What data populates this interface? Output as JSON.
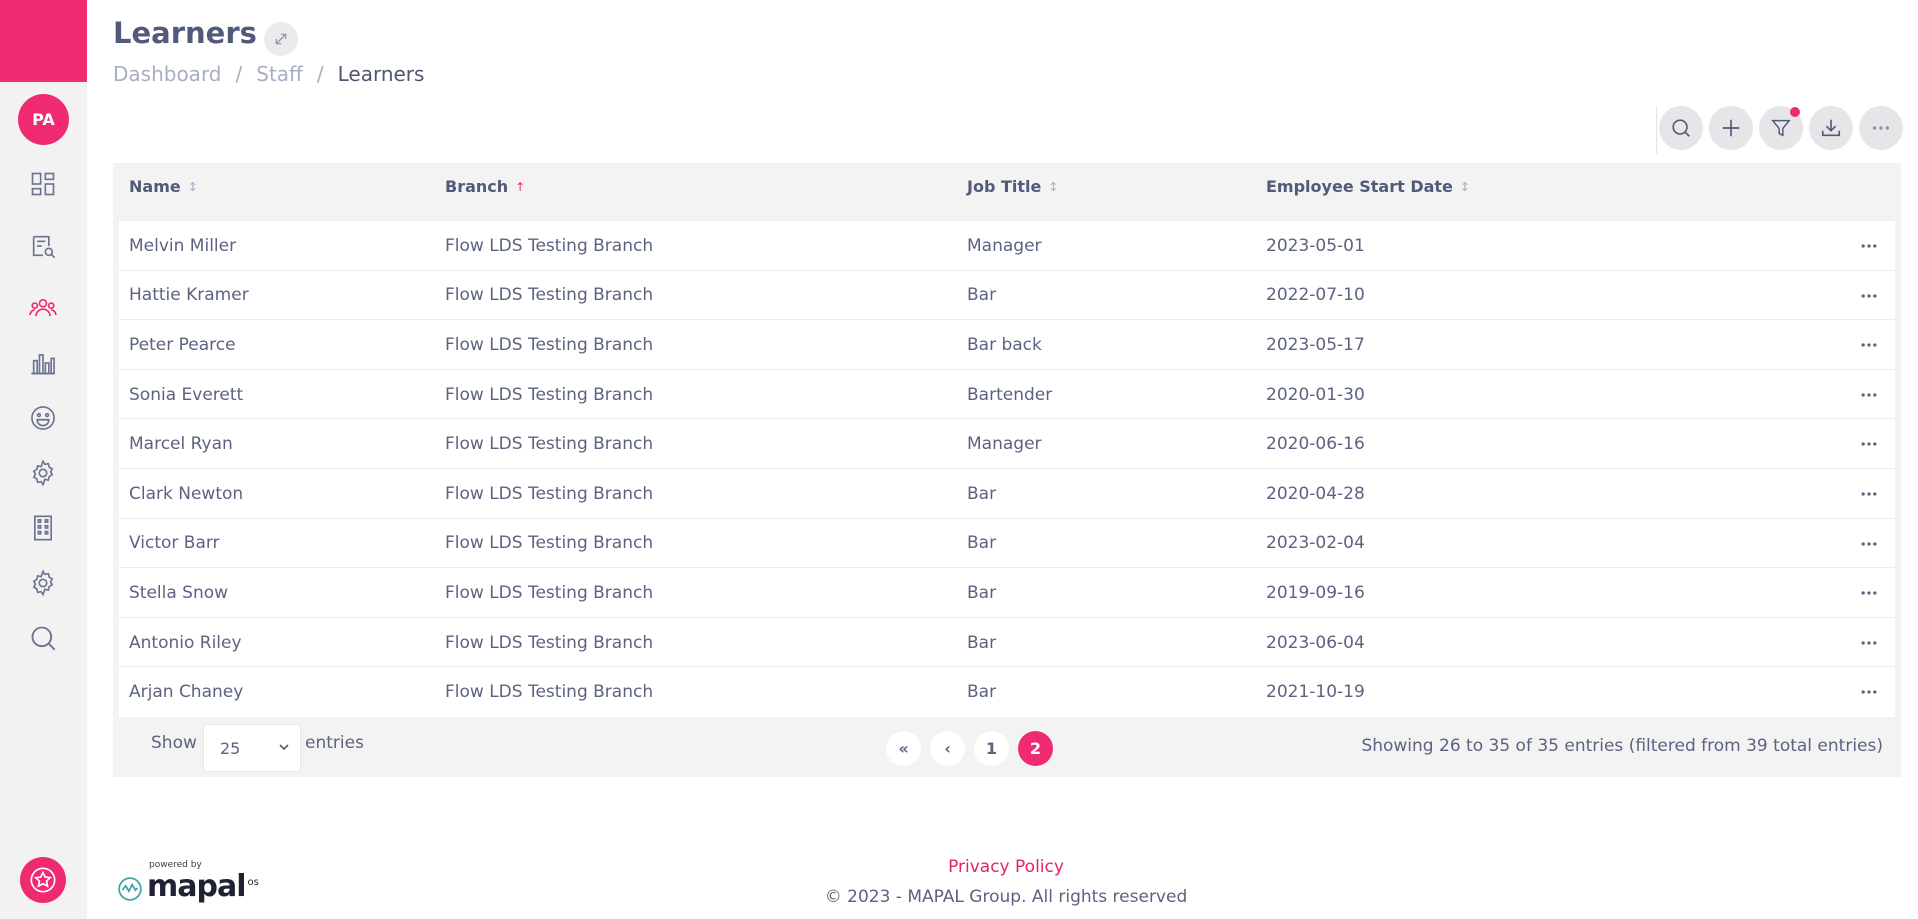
{
  "user": {
    "initials": "PA"
  },
  "page": {
    "title": "Learners"
  },
  "breadcrumb": [
    "Dashboard",
    "Staff",
    "Learners"
  ],
  "colors": {
    "accent": "#ef2a70",
    "text": "#5c6380",
    "muted": "#a7aec4"
  },
  "sidebar": {
    "items": [
      {
        "icon": "dashboard-icon",
        "active": false
      },
      {
        "icon": "course-search-icon",
        "active": false
      },
      {
        "icon": "people-icon",
        "active": true
      },
      {
        "icon": "bar-chart-icon",
        "active": false
      },
      {
        "icon": "smiley-icon",
        "active": false
      },
      {
        "icon": "gear-icon",
        "active": false
      },
      {
        "icon": "building-icon",
        "active": false
      },
      {
        "icon": "gear-icon",
        "active": false
      },
      {
        "icon": "search-icon",
        "active": false
      }
    ]
  },
  "toolbar": {
    "buttons": [
      "search-icon",
      "plus-icon",
      "filter-icon",
      "download-icon",
      "more-icon"
    ]
  },
  "table": {
    "columns": [
      {
        "label": "Name",
        "sort": "none"
      },
      {
        "label": "Branch",
        "sort": "asc"
      },
      {
        "label": "Job Title",
        "sort": "none"
      },
      {
        "label": "Employee Start Date",
        "sort": "none"
      }
    ],
    "rows": [
      {
        "name": "Melvin Miller",
        "branch": "Flow LDS Testing Branch",
        "job": "Manager",
        "date": "2023-05-01"
      },
      {
        "name": "Hattie Kramer",
        "branch": "Flow LDS Testing Branch",
        "job": "Bar",
        "date": "2022-07-10"
      },
      {
        "name": "Peter Pearce",
        "branch": "Flow LDS Testing Branch",
        "job": "Bar back",
        "date": "2023-05-17"
      },
      {
        "name": "Sonia Everett",
        "branch": "Flow LDS Testing Branch",
        "job": "Bartender",
        "date": "2020-01-30"
      },
      {
        "name": "Marcel Ryan",
        "branch": "Flow LDS Testing Branch",
        "job": "Manager",
        "date": "2020-06-16"
      },
      {
        "name": "Clark Newton",
        "branch": "Flow LDS Testing Branch",
        "job": "Bar",
        "date": "2020-04-28"
      },
      {
        "name": "Victor Barr",
        "branch": "Flow LDS Testing Branch",
        "job": "Bar",
        "date": "2023-02-04"
      },
      {
        "name": "Stella Snow",
        "branch": "Flow LDS Testing Branch",
        "job": "Bar",
        "date": "2019-09-16"
      },
      {
        "name": "Antonio Riley",
        "branch": "Flow LDS Testing Branch",
        "job": "Bar",
        "date": "2023-06-04"
      },
      {
        "name": "Arjan Chaney",
        "branch": "Flow LDS Testing Branch",
        "job": "Bar",
        "date": "2021-10-19"
      }
    ]
  },
  "pagination": {
    "show_label": "Show",
    "entries_value": "25",
    "entries_label": "entries",
    "first": "«",
    "prev": "‹",
    "pages": [
      "1",
      "2"
    ],
    "current_page": "2",
    "info": "Showing 26 to 35 of 35 entries (filtered from 39 total entries)"
  },
  "footer": {
    "powered_by": "powered by",
    "brand": "mapal",
    "brand_suffix": "os",
    "privacy": "Privacy Policy",
    "copyright": "© 2023 - MAPAL Group. All rights reserved"
  }
}
